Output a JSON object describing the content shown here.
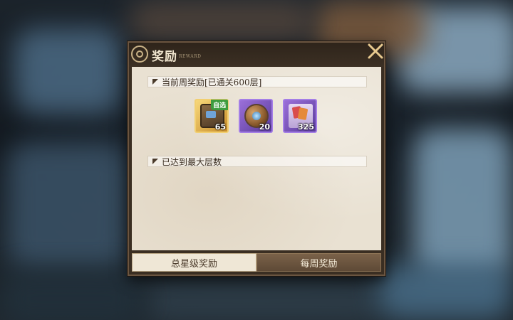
{
  "dialog": {
    "title": "奖励",
    "title_en": "REWARD"
  },
  "sections": {
    "current_week": {
      "label": "当前周奖励[已通关600层]"
    },
    "max_floor": {
      "label": "已达到最大层数"
    }
  },
  "rewards": [
    {
      "icon": "supply-chest-icon",
      "tag": "自选",
      "quantity": "65",
      "rarity_color": "#e9b84a"
    },
    {
      "icon": "bronze-sphere-icon",
      "tag": "",
      "quantity": "20",
      "rarity_color": "#8a63cf"
    },
    {
      "icon": "card-pack-icon",
      "tag": "",
      "quantity": "325",
      "rarity_color": "#8a63cf"
    }
  ],
  "tabs": [
    {
      "label": "总星级奖励",
      "active": false
    },
    {
      "label": "每周奖励",
      "active": true
    }
  ],
  "colors": {
    "frame": "#3a2e22",
    "panel": "#e9e1d2",
    "tab_active": "#6b5540",
    "close_icon": "#e7c98f"
  }
}
